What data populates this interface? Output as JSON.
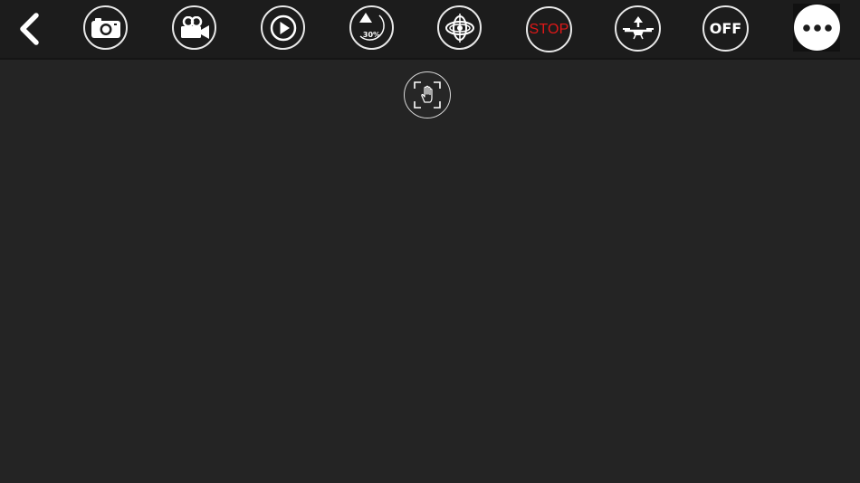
{
  "toolbar": {
    "back": {
      "icon": "back-chevron-icon"
    },
    "photo": {
      "icon": "camera-icon"
    },
    "video": {
      "icon": "video-camera-icon"
    },
    "playback": {
      "icon": "play-icon"
    },
    "speed": {
      "icon": "speed-gauge-icon",
      "value_label": "30%"
    },
    "gyro_calibrate": {
      "icon": "gyro-icon"
    },
    "emergency_stop": {
      "label": "STOP"
    },
    "takeoff": {
      "icon": "drone-takeoff-icon"
    },
    "power": {
      "label": "OFF"
    },
    "more": {
      "icon": "more-dots-icon"
    }
  },
  "main": {
    "gesture_control": {
      "icon": "hand-gesture-icon"
    }
  },
  "colors": {
    "background": "#242424",
    "toolbar": "#1c1c1c",
    "stop_red": "#e01818",
    "icon_white": "#ffffff"
  }
}
